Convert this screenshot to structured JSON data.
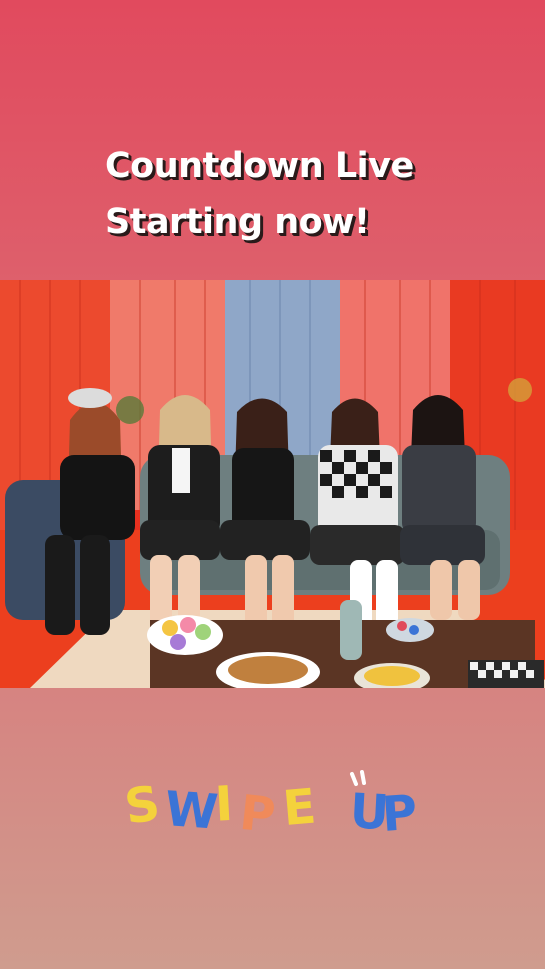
{
  "story": {
    "headline_line1": "Countdown Live",
    "headline_line2": "Starting now!",
    "photo_icon": "group-photo-image",
    "swipe": {
      "letters": [
        "S",
        "W",
        "I",
        "P",
        "E",
        "U",
        "P"
      ],
      "colors": [
        "#f4d23c",
        "#3b74d6",
        "#f4d23c",
        "#f08a5a",
        "#f4d23c",
        "#3b74d6",
        "#3b74d6"
      ],
      "label": "SWIPE UP"
    }
  }
}
